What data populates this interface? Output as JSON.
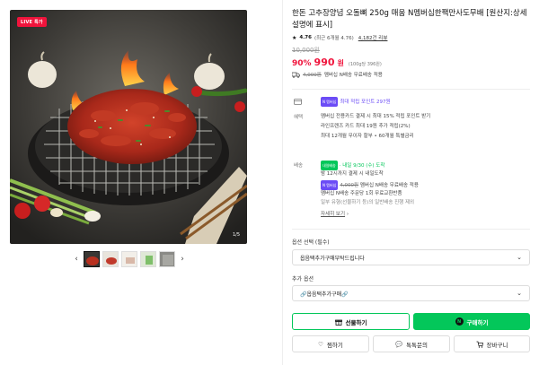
{
  "gallery": {
    "live_badge": "LIVE 특가",
    "counter": "1/5",
    "prev_icon": "chevron-left",
    "next_icon": "chevron-right",
    "thumbnails": 5
  },
  "product": {
    "title": "한돈 고추장양념 오돌뼈 250g 매움 N멤버십한팩만사도무배 [원산지:상세설명에 표시]",
    "rating": "4.76",
    "rating_detail": "(최근 6개월 4.76)",
    "review_count": "4,182건 리뷰",
    "original_price": "10,000원",
    "discount": "90%",
    "price": "990",
    "price_unit": "원",
    "unit_price": "(100g당 396원)",
    "member_strike": "4,000원",
    "member_text": "멤버십 N배송 무료배송 적용"
  },
  "points": {
    "badge": "N 멤버십",
    "text": "최대 적립 포인트 297원"
  },
  "benefits": {
    "label": "혜택",
    "lines": [
      "멤버십 전용카드 결제 시 최대 15% 적립 포인트 받기",
      "라인프렌즈 카드 최대 19원 추가 적립(2%)",
      "최대 12개월 무이자 할부 • 60개월 특별금리"
    ]
  },
  "shipping": {
    "label": "배송",
    "badge": "내일배송",
    "arrival": "· 내일 9/30 (수) 도착",
    "line2": "밤 12시까지 결제 시 내일도착",
    "line3_strike": "4,000원",
    "line3": "멤버십 N배송 무료배송 적용",
    "line4": "멤버십 N배송 주문당 1회 무료교환반품",
    "line5": "일부 유형(선물하기 등)의 일반배송 진행 제외",
    "more": "자세히 보기"
  },
  "options": {
    "label": "옵션 선택 (필수)",
    "value": "옵음택추가구매부탁드립니다",
    "add_label": "추가 옵션",
    "add_value": "🔗옵음택추가구매🔗"
  },
  "buttons": {
    "gift": "선물하기",
    "buy": "구매하기",
    "wish": "찜하기",
    "talk": "톡톡문의",
    "cart": "장바구니"
  },
  "colors": {
    "accent": "#03c75a",
    "sale": "#f0143c",
    "member": "#6b4cf6"
  }
}
